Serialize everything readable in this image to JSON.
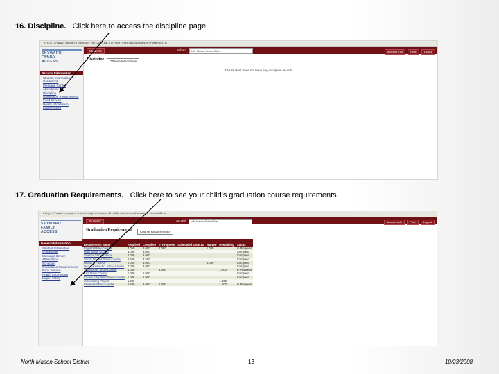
{
  "slide": {
    "step16": {
      "label": "16. Discipline.",
      "text": "Click here to access the discipline page."
    },
    "step17": {
      "label": "17. Graduation Requirements.",
      "text": "Click here to see your child's graduation course requirements."
    },
    "footer_left": "North Mason School District",
    "page_number": "13",
    "footer_date": "10/23/2008"
  },
  "common": {
    "logo_lines": [
      "SKYWARD",
      "FAMILY",
      "ACCESS"
    ],
    "students_button": "Students",
    "school_label": "School",
    "select_value": "Nth. Mason School Dist...",
    "buttons": [
      "Account Info",
      "Print",
      "Logout"
    ],
    "sidebar_header": "General Information"
  },
  "screenshot1": {
    "url": "https://www2.skyward.com/scripts/wsisa.dll/WService=wsedunmason/fwemnu01.w",
    "title": "Discipline",
    "tab": "Offense Information",
    "message": "This student does not have any discipline records.",
    "sidebar_items": [
      "Student Information",
      "Gradebook",
      "Message Center",
      "Attendance",
      "Discipline",
      "Graduation Requirements",
      "Food Service",
      "Health Information",
      "Login History"
    ]
  },
  "screenshot2": {
    "url": "https://www2.skyward.com/scripts/wsisa.dll/WService=wsedunmason/fwemnu01.w",
    "title": "Graduation Requirements",
    "tab": "Course Requirements",
    "sidebar_items": [
      "Student Information",
      "Gradebook",
      "Message Center",
      "Attendance",
      "Schedule",
      "Graduation Requirements",
      "Food Service",
      "Health Information",
      "Login History"
    ],
    "table": {
      "headers": [
        "Requirement Name",
        "Required",
        "Complete",
        "In Progress",
        "Scheduled 2009-10",
        "Waived",
        "Remaining",
        "Status"
      ],
      "rows": [
        [
          "English Show Course",
          "4.000",
          "2.000",
          "1.000",
          "",
          "1.000",
          "",
          "In Progress"
        ],
        [
          "Math Show Course",
          "3.000",
          "3.000",
          "",
          "",
          "",
          "",
          "Complete"
        ],
        [
          "Science Show Course",
          "2.000",
          "2.000",
          "",
          "",
          "",
          "",
          "Complete"
        ],
        [
          "Social Studies Show Course",
          "2.500",
          "2.500",
          "",
          "",
          "",
          "",
          "Complete"
        ],
        [
          "Health & Fitness",
          "2.000",
          "1.000",
          "",
          "",
          "1.000",
          "",
          "Complete"
        ],
        [
          "Occupational Ed. Show Course",
          "2.000",
          "2.000",
          "",
          "",
          "",
          "",
          "Complete"
        ],
        [
          "Technology Show Course",
          "1.000",
          "",
          "1.000",
          "",
          "",
          "1.000",
          "In Progress"
        ],
        [
          "Arts Show Course",
          "1.000",
          "1.000",
          "",
          "",
          "",
          "",
          "Complete"
        ],
        [
          "Career Education Show Course",
          "1.000",
          "1.000",
          "",
          "",
          "",
          "",
          "Complete"
        ],
        [
          "Culminating Project",
          "1.000",
          "",
          "",
          "",
          "",
          "1.000",
          ""
        ],
        [
          "Electives Show Course",
          "5.500",
          "4.000",
          "1.000",
          "",
          "",
          "1.000",
          "In Progress"
        ]
      ]
    }
  }
}
